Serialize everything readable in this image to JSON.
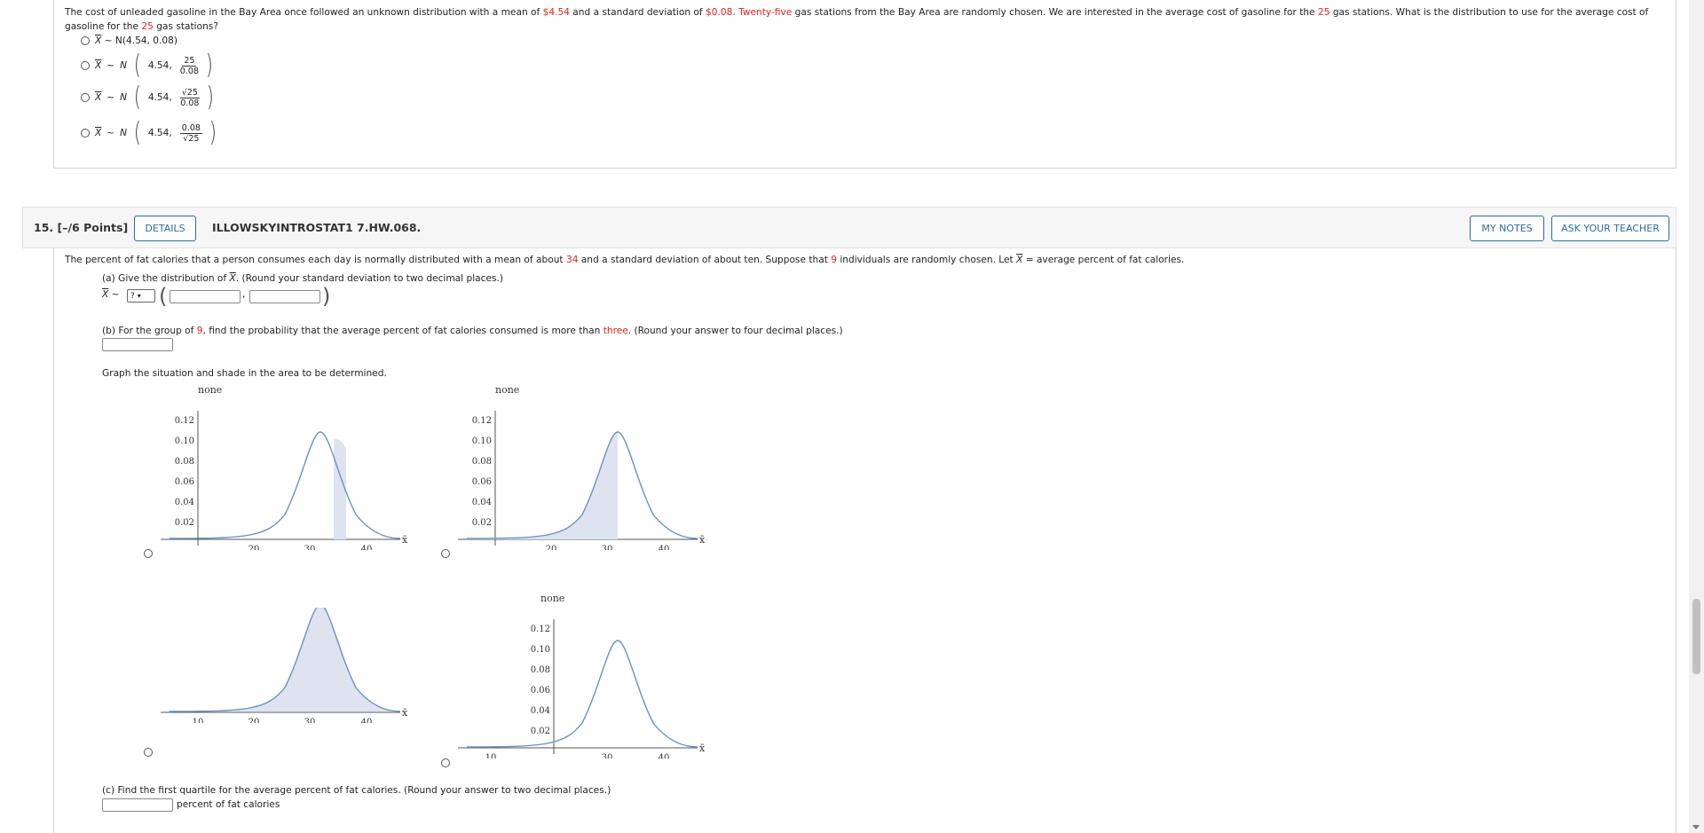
{
  "q14": {
    "text_parts": [
      "The cost of unleaded gasoline in the Bay Area once followed an unknown distribution with a mean of ",
      "$4.54",
      " and a standard deviation of ",
      "$0.08",
      ". ",
      "Twenty-five",
      " gas stations from the Bay Area are randomly chosen. We are interested in the average cost of gasoline for the ",
      "25",
      " gas stations. What is the distribution to use for the average cost of gasoline for the ",
      "25",
      " gas stations?"
    ],
    "options": [
      {
        "xbar": "X",
        "tilde": "~",
        "dist": "N(4.54, 0.08)"
      },
      {
        "xbar": "X",
        "tilde": "~",
        "N": "N",
        "first": "4.54,",
        "num": "25",
        "den": "0.08"
      },
      {
        "xbar": "X",
        "tilde": "~",
        "N": "N",
        "first": "4.54,",
        "num": "√25",
        "den": "0.08"
      },
      {
        "xbar": "X",
        "tilde": "~",
        "N": "N",
        "first": "4.54,",
        "num": "0.08",
        "den": "√25"
      }
    ]
  },
  "q15": {
    "number": "15.",
    "points": "[–/6 Points]",
    "details_label": "DETAILS",
    "code": "ILLOWSKYINTROSTAT1 7.HW.068.",
    "my_notes_label": "MY NOTES",
    "ask_teacher_label": "ASK YOUR TEACHER",
    "intro_parts": [
      "The percent of fat calories that a person consumes each day is normally distributed with a mean of about ",
      "34",
      " and a standard deviation of about ten. Suppose that ",
      "9",
      " individuals are randomly chosen. Let ",
      "X",
      " = average  percent of fat calories."
    ],
    "part_a": {
      "prefix": "(a) Give the distribution of ",
      "xbar": "X",
      "suffix": ". (Round your standard deviation to two decimal places.)",
      "lhs_xbar": "X",
      "tilde": "~",
      "select_value": "?",
      "comma": ","
    },
    "part_b_parts": [
      "(b) For the group of ",
      "9",
      ", find the probability that the average percent of fat calories consumed is more than ",
      "three",
      ". (Round your answer to four decimal places.)"
    ],
    "graph_prompt": "Graph the situation and shade in the area to be determined.",
    "graph_titles": [
      "none",
      "none",
      "none"
    ],
    "y_ticks": [
      "0.12",
      "0.10",
      "0.08",
      "0.06",
      "0.04",
      "0.02"
    ],
    "x_axis_label": "x̄",
    "graphs": [
      {
        "x_ticks": [
          "20",
          "30",
          "40"
        ]
      },
      {
        "x_ticks": [
          "20",
          "30",
          "40"
        ]
      },
      {
        "x_ticks": [
          "10",
          "20",
          "30",
          "40"
        ]
      },
      {
        "x_ticks": [
          "10",
          "30",
          "40"
        ]
      }
    ],
    "part_c": "(c) Find the first quartile for the average percent of fat calories. (Round your answer to two decimal places.)",
    "part_c_unit": "percent of fat calories"
  },
  "colors": {
    "accent_red": "#e0231a",
    "button_blue": "#2d6ca2",
    "curve_blue": "#6d8fc5",
    "shade": "#dde4f0"
  }
}
